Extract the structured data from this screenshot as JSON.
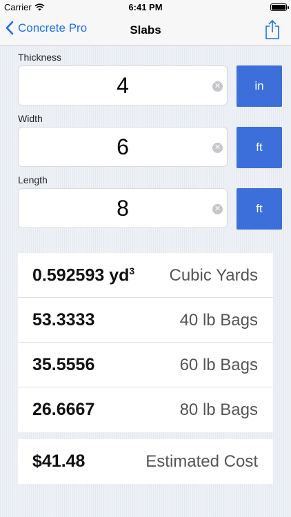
{
  "status_bar": {
    "carrier": "Carrier",
    "time": "6:41 PM",
    "battery_level": 1.0
  },
  "nav": {
    "back_label": "Concrete Pro",
    "title": "Slabs",
    "share_icon": "share-icon"
  },
  "inputs": [
    {
      "label": "Thickness",
      "value": "4",
      "unit": "in"
    },
    {
      "label": "Width",
      "value": "6",
      "unit": "ft"
    },
    {
      "label": "Length",
      "value": "8",
      "unit": "ft"
    }
  ],
  "clear_glyph": "✕",
  "results": [
    {
      "value": "0.592593 yd",
      "superscript": "3",
      "label": "Cubic Yards"
    },
    {
      "value": "53.3333",
      "label": "40 lb Bags"
    },
    {
      "value": "35.5556",
      "label": "60 lb Bags"
    },
    {
      "value": "26.6667",
      "label": "80 lb Bags"
    }
  ],
  "cost": {
    "value": "$41.48",
    "label": "Estimated Cost"
  },
  "colors": {
    "accent": "#1a6ef5",
    "unit_button": "#3c6fd9"
  }
}
